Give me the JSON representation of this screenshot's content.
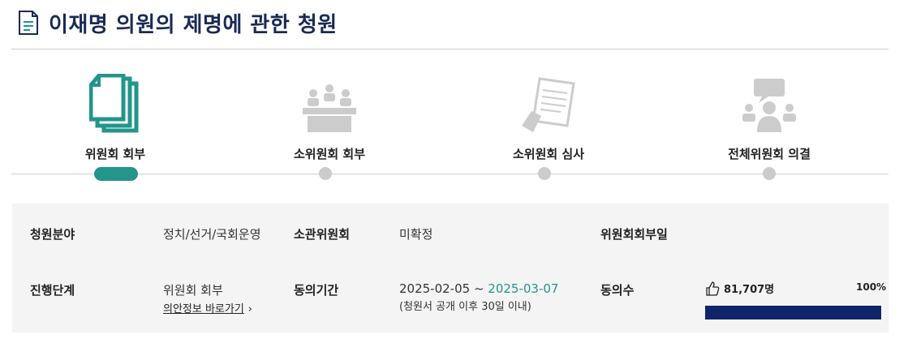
{
  "page": {
    "title": "이재명 의원의 제명에 관한 청원"
  },
  "steps": [
    {
      "label": "위원회 회부",
      "icon": "documents-icon",
      "active": true
    },
    {
      "label": "소위원회 회부",
      "icon": "meeting-table-icon",
      "active": false
    },
    {
      "label": "소위원회 심사",
      "icon": "review-document-icon",
      "active": false
    },
    {
      "label": "전체위원회 의결",
      "icon": "discussion-group-icon",
      "active": false
    }
  ],
  "info": {
    "field_label": "청원분야",
    "field_value": "정치/선거/국회운영",
    "committee_label": "소관위원회",
    "committee_value": "미확정",
    "referral_date_label": "위원회회부일",
    "referral_date_value": "",
    "stage_label": "진행단계",
    "stage_value": "위원회 회부",
    "stage_link": "의안정보 바로가기",
    "period_label": "동의기간",
    "period_start": "2025-02-05 ~ ",
    "period_end": "2025-03-07",
    "period_note": "(청원서 공개 이후 30일 이내)",
    "agree_label": "동의수",
    "agree_count": "81,707명",
    "agree_percent": "100%",
    "agree_fraction": 1.0
  },
  "colors": {
    "accent": "#23958a",
    "title": "#1a2a55",
    "progress": "#10246a",
    "inactive": "#cccccc"
  }
}
